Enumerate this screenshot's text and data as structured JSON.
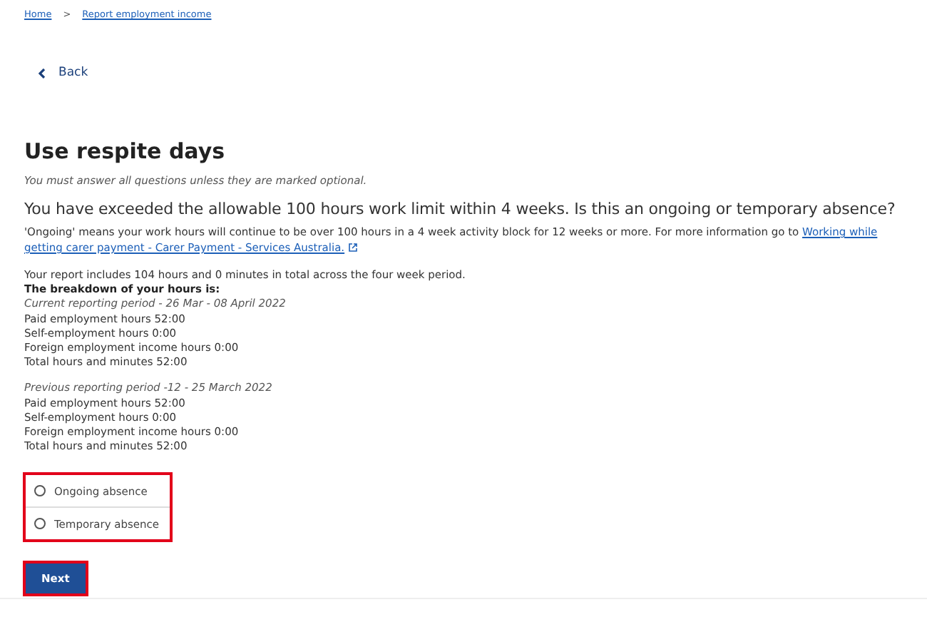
{
  "breadcrumbs": [
    {
      "label": "Home"
    },
    {
      "label": "Report employment income"
    }
  ],
  "breadcrumb_separator": ">",
  "back": {
    "label": "Back"
  },
  "title": "Use respite days",
  "note": "You must answer all questions unless they are marked optional.",
  "question": "You have exceeded the allowable 100 hours work limit within 4 weeks. Is this an ongoing or temporary absence?",
  "info": {
    "text": "'Ongoing' means your work hours will continue to be over 100 hours in a 4 week activity block for 12 weeks or more. For more information go to",
    "link_lines": [
      "Working while",
      "getting carer payment - Carer Payment - Services Australia."
    ]
  },
  "summary": "Your report includes 104 hours and 0 minutes in total across the four week period.",
  "breakdown_heading": "The breakdown of your hours is:",
  "periods": [
    {
      "heading": "Current reporting period - 26 Mar - 08 April 2022",
      "lines": [
        "Paid employment hours 52:00",
        "Self-employment hours 0:00",
        "Foreign employment income hours 0:00",
        "Total hours and minutes 52:00"
      ]
    },
    {
      "heading": "Previous reporting period -12 - 25 March 2022",
      "lines": [
        "Paid employment hours 52:00",
        "Self-employment hours 0:00",
        "Foreign employment income hours 0:00",
        "Total hours and minutes 52:00"
      ]
    }
  ],
  "options": [
    {
      "label": "Ongoing absence",
      "selected": false
    },
    {
      "label": "Temporary absence",
      "selected": false
    }
  ],
  "button": "Next"
}
